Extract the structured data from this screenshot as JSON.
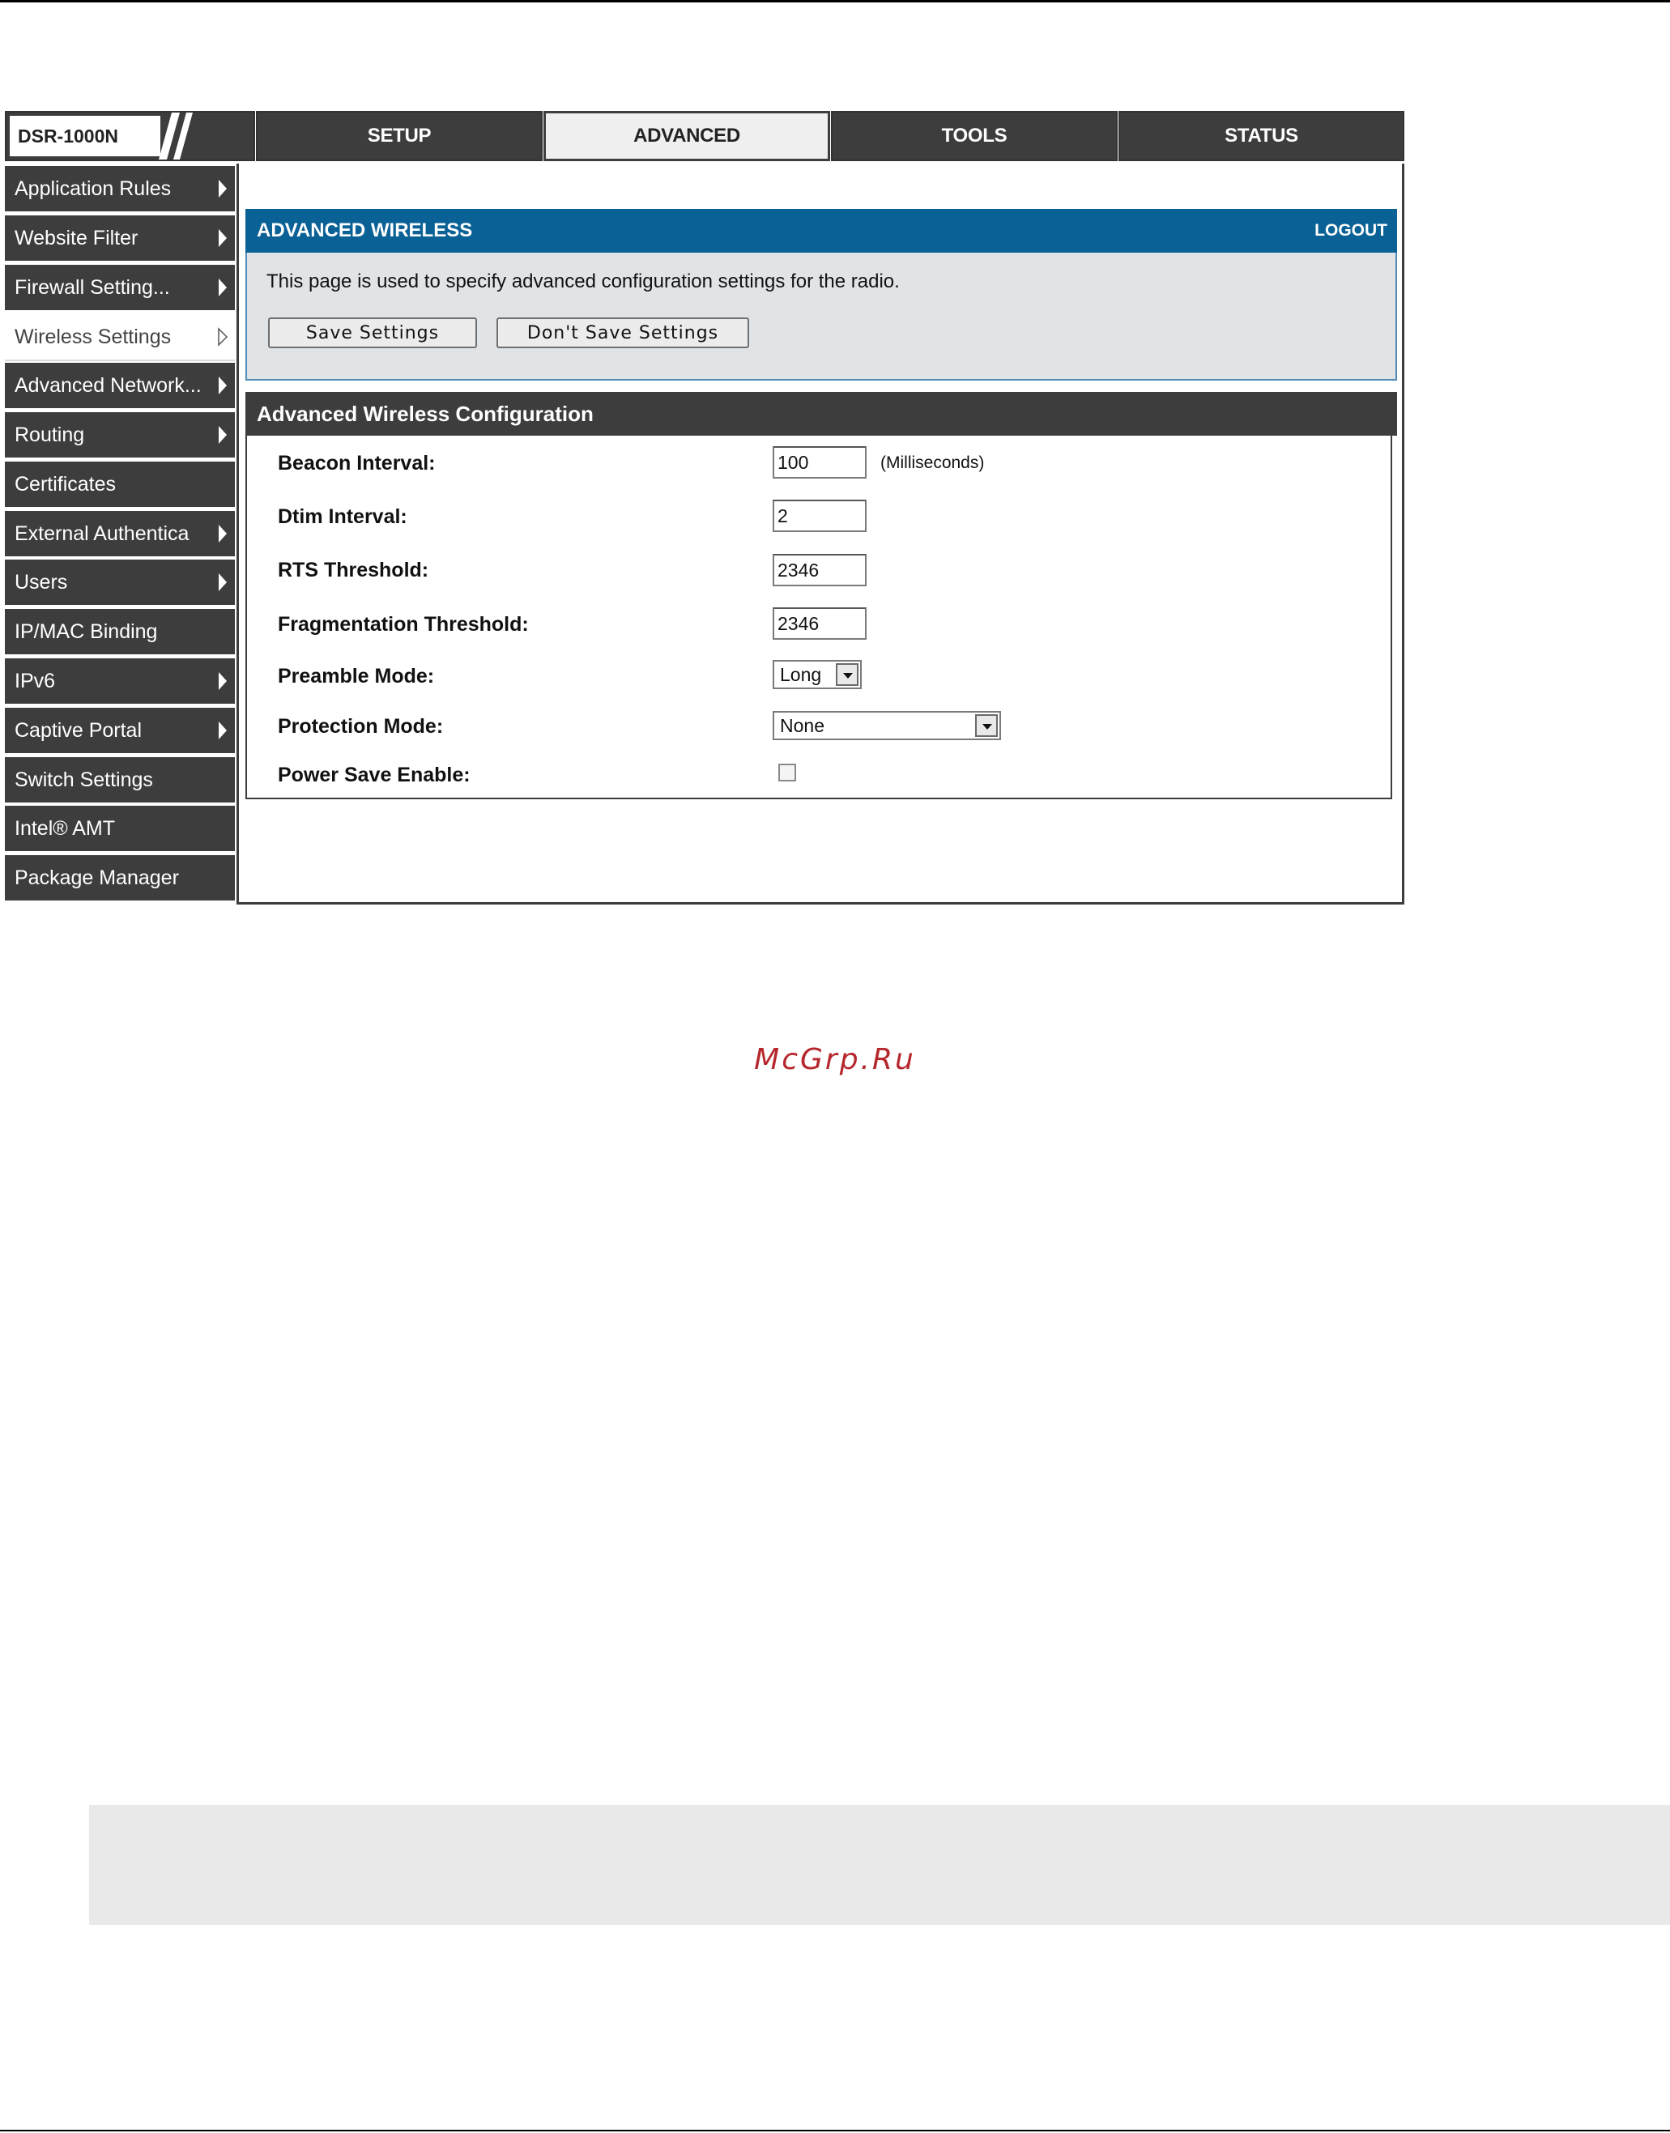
{
  "header": {
    "logo_text": "DSR-1000N",
    "tabs": [
      "SETUP",
      "ADVANCED",
      "TOOLS",
      "STATUS"
    ],
    "active_tab": "ADVANCED"
  },
  "sidebar": {
    "items": [
      {
        "label": "Application Rules",
        "arrow": true
      },
      {
        "label": "Website Filter",
        "arrow": true
      },
      {
        "label": "Firewall Setting...",
        "arrow": true
      },
      {
        "label": "Wireless Settings",
        "arrow": true,
        "active": true
      },
      {
        "label": "Advanced Network...",
        "arrow": true
      },
      {
        "label": "Routing",
        "arrow": true
      },
      {
        "label": "Certificates",
        "arrow": false
      },
      {
        "label": "External Authentica",
        "arrow": true
      },
      {
        "label": "Users",
        "arrow": true
      },
      {
        "label": "IP/MAC Binding",
        "arrow": false
      },
      {
        "label": "IPv6",
        "arrow": true
      },
      {
        "label": "Captive Portal",
        "arrow": true
      },
      {
        "label": "Switch Settings",
        "arrow": false
      },
      {
        "label": "Intel® AMT",
        "arrow": false
      },
      {
        "label": "Package Manager",
        "arrow": false
      }
    ]
  },
  "page": {
    "title": "ADVANCED WIRELESS",
    "logout": "LOGOUT",
    "description": "This page is used to specify advanced configuration settings for the radio.",
    "save_label": "Save Settings",
    "dont_save_label": "Don't Save Settings"
  },
  "config": {
    "title": "Advanced Wireless Configuration",
    "beacon_label": "Beacon Interval:",
    "beacon_value": "100",
    "beacon_unit": "(Milliseconds)",
    "dtim_label": "Dtim Interval:",
    "dtim_value": "2",
    "rts_label": "RTS Threshold:",
    "rts_value": "2346",
    "frag_label": "Fragmentation Threshold:",
    "frag_value": "2346",
    "preamble_label": "Preamble Mode:",
    "preamble_value": "Long",
    "protection_label": "Protection Mode:",
    "protection_value": "None",
    "powersave_label": "Power Save Enable:",
    "powersave_checked": false
  },
  "watermark": "McGrp.Ru",
  "colors": {
    "dark_bar": "#3d3d3d",
    "header_blue": "#0a6196",
    "info_bg": "#e1e4e6",
    "watermark_red": "#b5272d"
  }
}
